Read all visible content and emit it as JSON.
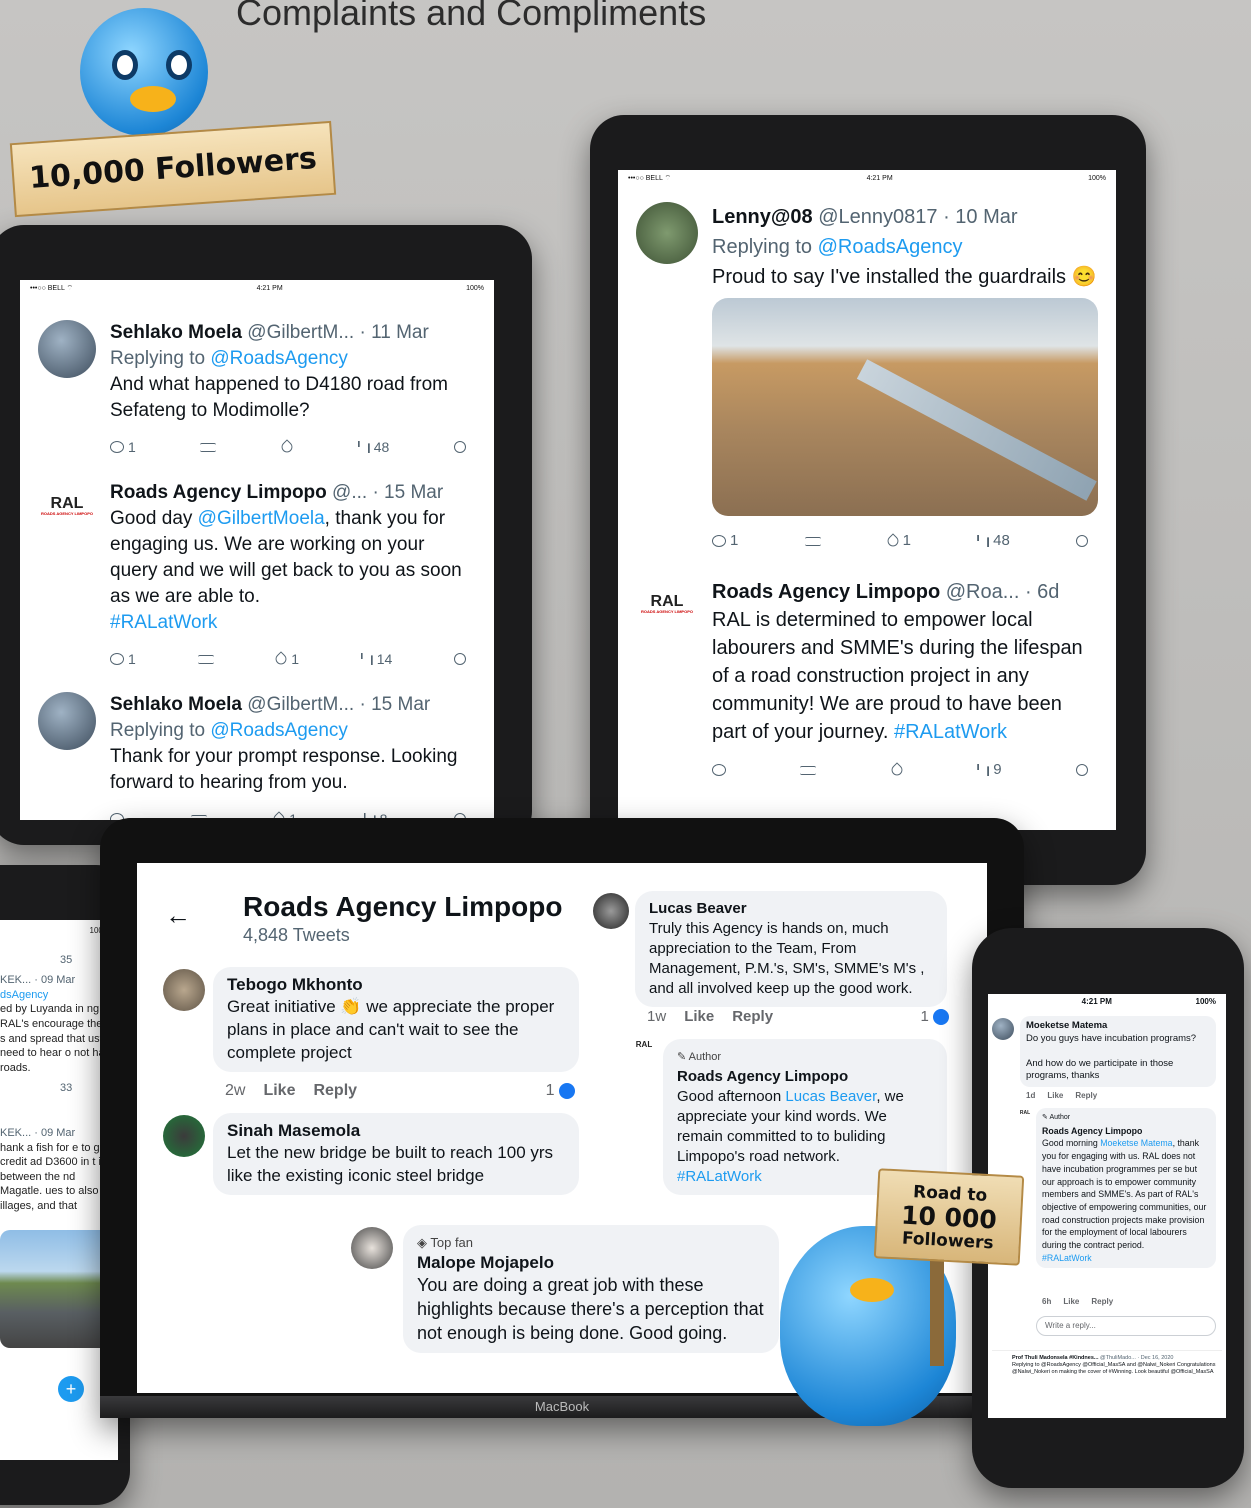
{
  "page_title": "Complaints and Compliments",
  "badge_top": "10,000 Followers",
  "tablet_left": {
    "status": {
      "carrier": "•••○○ BELL ⌔",
      "time": "4:21 PM",
      "battery": "100%"
    },
    "tweets": [
      {
        "name": "Sehlako Moela",
        "handle": "@GilbertM...",
        "date": "· 11 Mar",
        "replying": "Replying to ",
        "replying_to": "@RoadsAgency",
        "text": "And what happened to D4180 road from Sefateng to Modimolle?",
        "replies": "1",
        "retweets": "",
        "likes": "",
        "views": "48"
      },
      {
        "name": "Roads Agency Limpopo",
        "handle": "@...",
        "date": "· 15 Mar",
        "text_a": "Good day ",
        "mention": "@GilbertMoela",
        "text_b": ", thank you for engaging us. We are working on your query and we will get back to you as soon as we are able to.",
        "hashtag": "#RALatWork",
        "replies": "1",
        "retweets": "",
        "likes": "1",
        "views": "14"
      },
      {
        "name": "Sehlako Moela",
        "handle": "@GilbertM...",
        "date": "· 15 Mar",
        "replying": "Replying to ",
        "replying_to": "@RoadsAgency",
        "text": "Thank for your prompt response. Looking forward to hearing from you.",
        "replies": "",
        "retweets": "",
        "likes": "1",
        "views": "8"
      }
    ],
    "ral_logo": "RAL",
    "ral_logo_sub": "ROADS AGENCY LIMPOPO"
  },
  "tablet_right": {
    "status": {
      "carrier": "•••○○ BELL ⌔",
      "time": "4:21 PM",
      "battery": "100%"
    },
    "tweets": [
      {
        "name": "Lenny@08",
        "handle": "@Lenny0817",
        "date": "· 10 Mar",
        "replying": "Replying to ",
        "replying_to": "@RoadsAgency",
        "text": "Proud to say I've installed the guardrails 😊",
        "replies": "1",
        "retweets": "",
        "likes": "1",
        "views": "48"
      },
      {
        "name": "Roads Agency Limpopo",
        "handle": "@Roa...",
        "date": "· 6d",
        "text": "RAL is determined to empower local labourers and SMME's during the lifespan of a road construction project in any community! We are proud to have been part of your journey. ",
        "hashtag": "#RALatWork",
        "replies": "",
        "retweets": "",
        "likes": "",
        "views": "9"
      }
    ]
  },
  "phone_left": {
    "status_battery": "100%",
    "views_1": "35",
    "handle_1": "KEK... · 09 Mar",
    "reply_1": "dsAgency",
    "text_1": "ed by Luyanda in ng RAL's encourage them s and spread that ust need to hear o not have roads.",
    "views_2": "33",
    "handle_2": "KEK... · 09 Mar",
    "text_2": "hank a fish for e to give credit ad D3600 in t is between the nd Magatle. ues to also illages, and that",
    "fab": "+"
  },
  "laptop": {
    "brand": "MacBook",
    "back": "←",
    "page_name": "Roads Agency Limpopo",
    "tweet_count": "4,848 Tweets",
    "comments": [
      {
        "name": "Tebogo Mkhonto",
        "text": "Great initiative 👏 we appreciate the proper plans in place and can't wait to see the complete project",
        "time": "2w",
        "like": "Like",
        "reply": "Reply",
        "likes": "1"
      },
      {
        "name": "Sinah Masemola",
        "text": "Let the new bridge be  built to reach 100 yrs like the existing iconic steel bridge"
      },
      {
        "badge": "Top fan",
        "name": "Malope Mojapelo",
        "text": "You are doing a great job with these highlights because there's a perception that not enough is being done. Good going."
      },
      {
        "name": "Lucas Beaver",
        "text": "Truly this Agency is hands on, much appreciation to the Team, From Management, P.M.'s, SM's, SMME's M's , and all involved keep up the good work.",
        "time": "1w",
        "like": "Like",
        "reply": "Reply",
        "likes": "1"
      },
      {
        "badge": "Author",
        "name": "Roads Agency Limpopo",
        "text_a": "Good afternoon ",
        "mention": "Lucas Beaver",
        "text_b": ", we appreciate your kind words. We remain committed to to buliding Limpopo's road network.",
        "hashtag": "#RALatWork"
      }
    ]
  },
  "phone_right": {
    "time": "4:21 PM",
    "battery": "100%",
    "c1_name": "Moeketse Matema",
    "c1_text": "Do you guys have incubation programs?",
    "c1_text2": "And how do we participate in those programs, thanks",
    "c1_time": "1d",
    "like": "Like",
    "reply": "Reply",
    "c2_badge": "Author",
    "c2_name": "Roads Agency Limpopo",
    "c2_a": "Good morning ",
    "c2_mention": "Moeketse Matema",
    "c2_b": ", thank you for engaging with us. RAL does not have incubation programmes per se but our approach is to empower community members and SMME's. As part of RAL's objective of empowering communities, our road construction projects make provision for the employment of local labourers during the contract period.",
    "c2_hashtag": "#RALatWork",
    "c2_time": "6h",
    "write_reply": "Write a reply...",
    "footer_name": "Prof Thuli Madonsela #Kindnes...",
    "footer_handle": "@ThuliMado... · Dec 16, 2020",
    "footer_text": "Replying to @RoadsAgency @Official_MasSA and @Nalwi_Nokeri Congratulations @Nalwi_Nokeri on making the cover of #Winning. Look beautiful @Official_MasSA"
  },
  "sign_text": "Road to",
  "sign_num": "10 000",
  "sign_sub": "Followers"
}
